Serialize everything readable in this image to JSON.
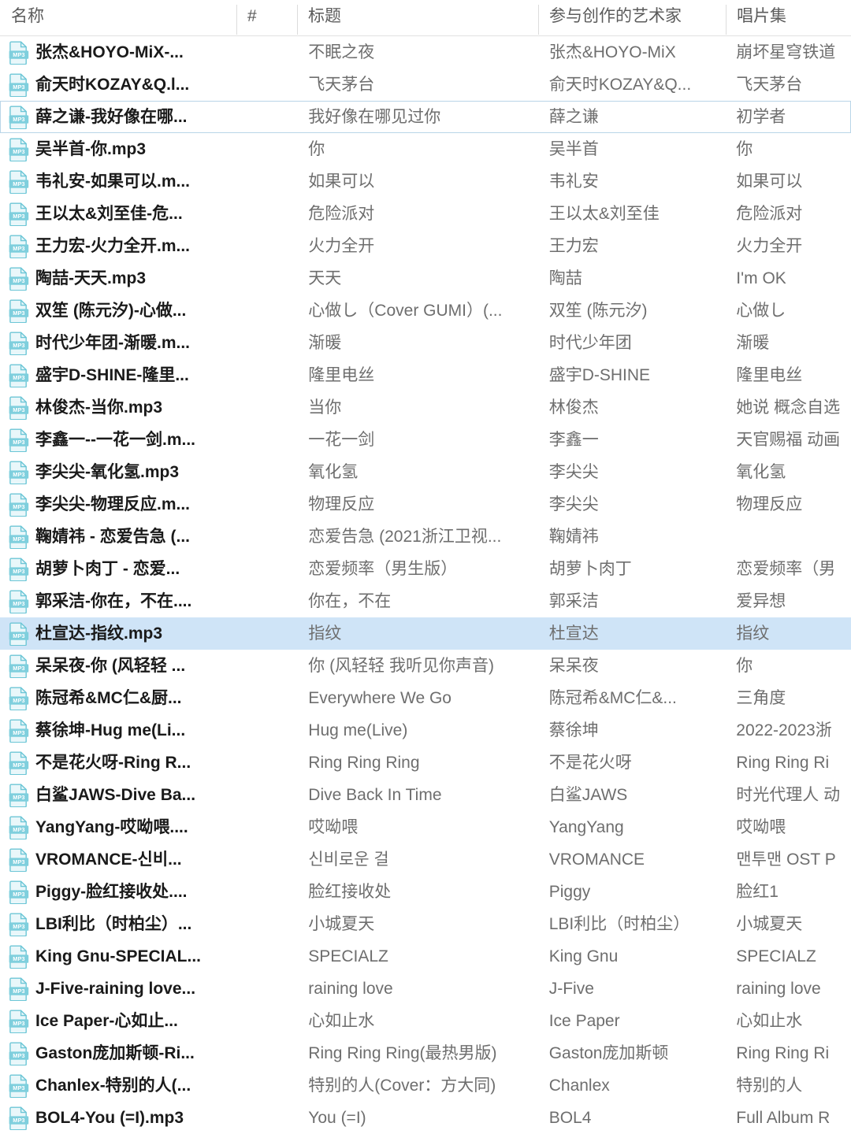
{
  "view": {
    "type": "file-explorer-details-list",
    "selection_color": "#cfe4f7",
    "focus_outline_color": "#b9d5e8",
    "header_text_color": "#5b5b5b",
    "name_text_color": "#1a1a1a",
    "meta_text_color": "#6e6e6e"
  },
  "columns": [
    {
      "key": "name",
      "label": "名称"
    },
    {
      "key": "num",
      "label": "#"
    },
    {
      "key": "title",
      "label": "标题"
    },
    {
      "key": "artist",
      "label": "参与创作的艺术家"
    },
    {
      "key": "album",
      "label": "唱片集"
    }
  ],
  "icon": {
    "name": "mp3-file-icon",
    "label": "MP3"
  },
  "rows": [
    {
      "name": "张杰&HOYO-MiX-...",
      "num": "",
      "title": "不眠之夜",
      "artist": "张杰&HOYO-MiX",
      "album": "崩坏星穹铁道",
      "state": "normal"
    },
    {
      "name": "俞天时KOZAY&Q.l...",
      "num": "",
      "title": "飞天茅台",
      "artist": "俞天时KOZAY&Q...",
      "album": "飞天茅台",
      "state": "normal"
    },
    {
      "name": "薛之谦-我好像在哪...",
      "num": "",
      "title": "我好像在哪见过你",
      "artist": "薛之谦",
      "album": "初学者",
      "state": "focused"
    },
    {
      "name": "吴半首-你.mp3",
      "num": "",
      "title": "你",
      "artist": "吴半首",
      "album": "你",
      "state": "normal"
    },
    {
      "name": "韦礼安-如果可以.m...",
      "num": "",
      "title": "如果可以",
      "artist": "韦礼安",
      "album": "如果可以",
      "state": "normal"
    },
    {
      "name": "王以太&刘至佳-危...",
      "num": "",
      "title": "危险派对",
      "artist": "王以太&刘至佳",
      "album": "危险派对",
      "state": "normal"
    },
    {
      "name": "王力宏-火力全开.m...",
      "num": "",
      "title": "火力全开",
      "artist": "王力宏",
      "album": "火力全开",
      "state": "normal"
    },
    {
      "name": "陶喆-天天.mp3",
      "num": "",
      "title": "天天",
      "artist": "陶喆",
      "album": "I'm OK",
      "state": "normal"
    },
    {
      "name": "双笙 (陈元汐)-心做...",
      "num": "",
      "title": "心做し（Cover GUMI）(...",
      "artist": "双笙 (陈元汐)",
      "album": "心做し",
      "state": "normal"
    },
    {
      "name": "时代少年团-渐暖.m...",
      "num": "",
      "title": "渐暖",
      "artist": "时代少年团",
      "album": "渐暖",
      "state": "normal"
    },
    {
      "name": "盛宇D-SHINE-隆里...",
      "num": "",
      "title": "隆里电丝",
      "artist": "盛宇D-SHINE",
      "album": "隆里电丝",
      "state": "normal"
    },
    {
      "name": "林俊杰-当你.mp3",
      "num": "",
      "title": "当你",
      "artist": "林俊杰",
      "album": "她说 概念自选",
      "state": "normal"
    },
    {
      "name": "李鑫一--一花一剑.m...",
      "num": "",
      "title": "一花一剑",
      "artist": "李鑫一",
      "album": "天官赐福 动画",
      "state": "normal"
    },
    {
      "name": "李尖尖-氧化氢.mp3",
      "num": "",
      "title": "氧化氢",
      "artist": "李尖尖",
      "album": "氧化氢",
      "state": "normal"
    },
    {
      "name": "李尖尖-物理反应.m...",
      "num": "",
      "title": "物理反应",
      "artist": "李尖尖",
      "album": "物理反应",
      "state": "normal"
    },
    {
      "name": "鞠婧祎 - 恋爱告急 (...",
      "num": "",
      "title": "恋爱告急 (2021浙江卫视...",
      "artist": "鞠婧祎",
      "album": "",
      "state": "normal"
    },
    {
      "name": "胡萝卜肉丁 - 恋爱...",
      "num": "",
      "title": "恋爱频率（男生版）",
      "artist": "胡萝卜肉丁",
      "album": "恋爱频率（男",
      "state": "normal"
    },
    {
      "name": "郭采洁-你在，不在....",
      "num": "",
      "title": "你在，不在",
      "artist": "郭采洁",
      "album": "爱异想",
      "state": "normal"
    },
    {
      "name": "杜宣达-指纹.mp3",
      "num": "",
      "title": "指纹",
      "artist": "杜宣达",
      "album": "指纹",
      "state": "selected"
    },
    {
      "name": "呆呆夜-你 (风轻轻 ...",
      "num": "",
      "title": "你 (风轻轻 我听见你声音)",
      "artist": "呆呆夜",
      "album": "你",
      "state": "normal"
    },
    {
      "name": "陈冠希&MC仁&厨...",
      "num": "",
      "title": "Everywhere We Go",
      "artist": "陈冠希&MC仁&...",
      "album": "三角度",
      "state": "normal"
    },
    {
      "name": "蔡徐坤-Hug me(Li...",
      "num": "",
      "title": "Hug me(Live)",
      "artist": "蔡徐坤",
      "album": "2022-2023浙",
      "state": "normal"
    },
    {
      "name": "不是花火呀-Ring R...",
      "num": "",
      "title": "Ring Ring Ring",
      "artist": "不是花火呀",
      "album": "Ring Ring Ri",
      "state": "normal"
    },
    {
      "name": "白鲨JAWS-Dive Ba...",
      "num": "",
      "title": "Dive Back In Time",
      "artist": "白鲨JAWS",
      "album": "时光代理人 动",
      "state": "normal"
    },
    {
      "name": "YangYang-哎呦喂....",
      "num": "",
      "title": "哎呦喂",
      "artist": "YangYang",
      "album": "哎呦喂",
      "state": "normal"
    },
    {
      "name": "VROMANCE-신비...",
      "num": "",
      "title": "신비로운 걸",
      "artist": "VROMANCE",
      "album": "맨투맨 OST P",
      "state": "normal"
    },
    {
      "name": "Piggy-脸红接收处....",
      "num": "",
      "title": "脸红接收处",
      "artist": "Piggy",
      "album": "脸红1",
      "state": "normal"
    },
    {
      "name": "LBI利比（时柏尘）...",
      "num": "",
      "title": "小城夏天",
      "artist": "LBI利比（时柏尘）",
      "album": "小城夏天",
      "state": "normal"
    },
    {
      "name": "King Gnu-SPECIAL...",
      "num": "",
      "title": "SPECIALZ",
      "artist": "King Gnu",
      "album": "SPECIALZ",
      "state": "normal"
    },
    {
      "name": "J-Five-raining love...",
      "num": "",
      "title": "raining love",
      "artist": "J-Five",
      "album": "raining love",
      "state": "normal"
    },
    {
      "name": "Ice Paper-心如止...",
      "num": "",
      "title": "心如止水",
      "artist": "Ice Paper",
      "album": "心如止水",
      "state": "normal"
    },
    {
      "name": "Gaston庞加斯顿-Ri...",
      "num": "",
      "title": "Ring Ring Ring(最热男版)",
      "artist": "Gaston庞加斯顿",
      "album": "Ring Ring Ri",
      "state": "normal"
    },
    {
      "name": "Chanlex-特别的人(...",
      "num": "",
      "title": "特别的人(Cover：方大同)",
      "artist": "Chanlex",
      "album": "特别的人",
      "state": "normal"
    },
    {
      "name": "BOL4-You (=I).mp3",
      "num": "",
      "title": "You (=I)",
      "artist": "BOL4",
      "album": "Full Album R",
      "state": "normal"
    }
  ]
}
